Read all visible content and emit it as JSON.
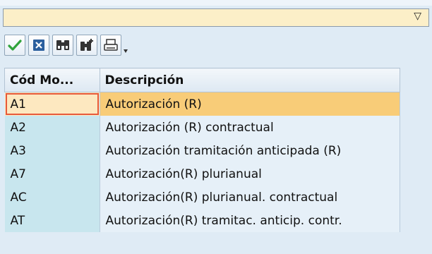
{
  "title_bar": {
    "filter_icon": "filter-triangle-icon"
  },
  "toolbar": {
    "buttons": [
      {
        "icon": "checkmark-icon",
        "color": "#2fa33b"
      },
      {
        "icon": "cancel-x-icon",
        "color": "#2b5f9e"
      },
      {
        "icon": "binoculars-icon"
      },
      {
        "icon": "binoculars-plus-icon"
      },
      {
        "icon": "printer-icon"
      }
    ],
    "dropdown_icon": "small-dropdown-icon"
  },
  "table": {
    "headers": {
      "code": "Cód Mo...",
      "description": "Descripción"
    },
    "rows": [
      {
        "code": "A1",
        "description": "Autorización (R)",
        "selected": true
      },
      {
        "code": "A2",
        "description": "Autorización (R) contractual"
      },
      {
        "code": "A3",
        "description": "Autorización tramitación anticipada (R)"
      },
      {
        "code": "A7",
        "description": "Autorización(R) plurianual"
      },
      {
        "code": "AC",
        "description": "Autorización(R) plurianual. contractual"
      },
      {
        "code": "AT",
        "description": "Autorización(R) tramitac. anticip. contr."
      }
    ]
  },
  "colors": {
    "selected_row": "#f8cc78",
    "code_column": "#c8e6ee",
    "description_column": "#e6f0f8",
    "selection_border": "#e65a3c"
  }
}
